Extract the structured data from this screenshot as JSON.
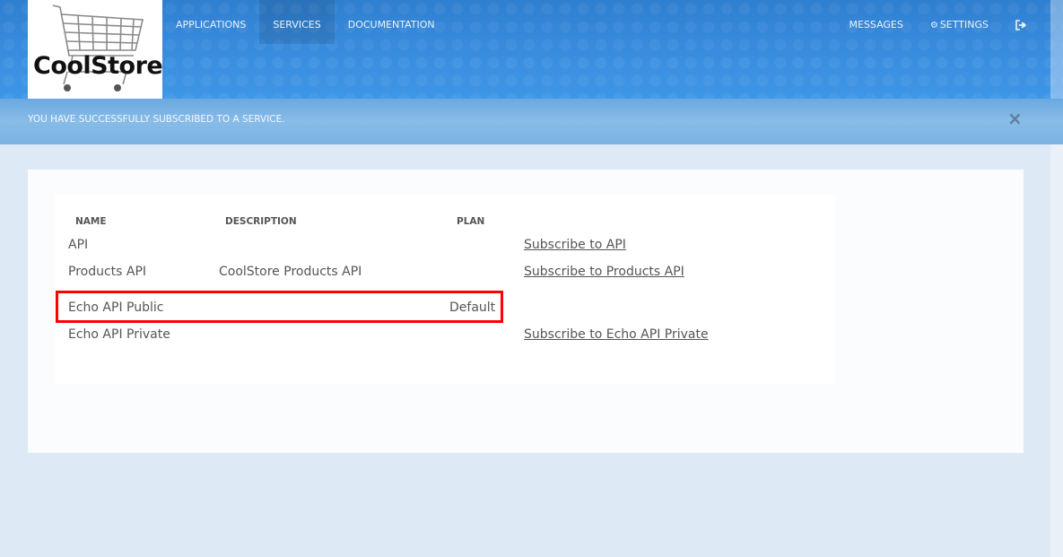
{
  "logo": {
    "text": "CoolStore"
  },
  "nav": {
    "left": [
      {
        "label": "APPLICATIONS",
        "active": false
      },
      {
        "label": "SERVICES",
        "active": true
      },
      {
        "label": "DOCUMENTATION",
        "active": false
      }
    ],
    "messages_label": "MESSAGES",
    "settings_label": "SETTINGS",
    "signout_icon": "sign-out-icon"
  },
  "notice": {
    "text": "YOU HAVE SUCCESSFULLY SUBSCRIBED TO A SERVICE.",
    "close_glyph": "×"
  },
  "table": {
    "headers": {
      "name": "NAME",
      "description": "DESCRIPTION",
      "plan": "PLAN"
    },
    "rows": [
      {
        "name": "API",
        "description": "",
        "plan": "",
        "action": "Subscribe to API"
      },
      {
        "name": "Products API",
        "description": "CoolStore Products API",
        "plan": "",
        "action": "Subscribe to Products API"
      },
      {
        "name": "Echo API Public",
        "description": "",
        "plan": "Default",
        "action": ""
      },
      {
        "name": "Echo API Private",
        "description": "",
        "plan": "",
        "action": "Subscribe to Echo API Private"
      }
    ]
  },
  "colors": {
    "header_blue": "#3a8ee0",
    "highlight_red": "#ff0000",
    "page_bg": "#dde9f5"
  }
}
